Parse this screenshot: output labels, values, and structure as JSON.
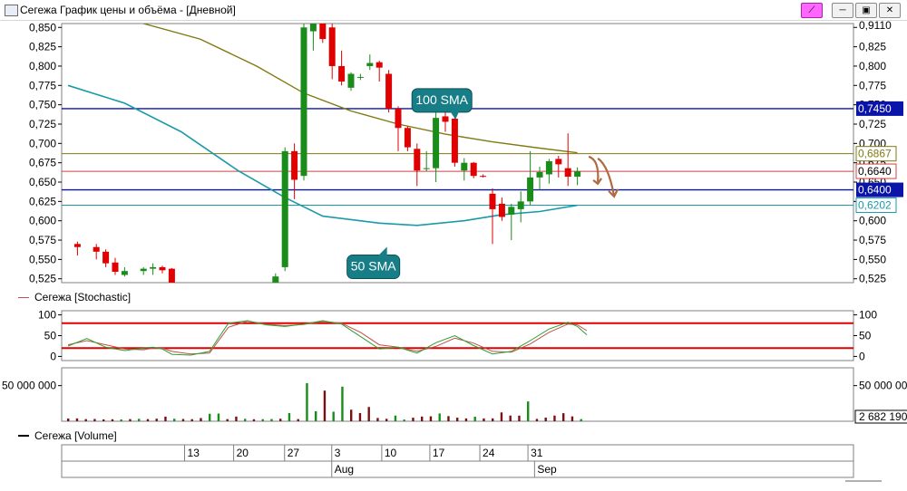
{
  "window": {
    "title": "Сегежа График цены и объёма - [Дневной]",
    "buttons": [
      "⟋",
      "─",
      "▣",
      "✕"
    ]
  },
  "colors": {
    "up_candle": "#1a8c1a",
    "down_candle": "#e00000",
    "sma50": "#1a9aa8",
    "sma100": "#807a12",
    "hline_blue": "#0a14a8",
    "hline_red": "#d04040",
    "callout_fill": "#177e88",
    "stoch_k": "#2aa02a",
    "stoch_d": "#c05050",
    "stoch_band": "#e00000",
    "arrow": "#b06a40"
  },
  "chart_data": [
    {
      "type": "candlestick",
      "panel": "price",
      "y_ticks": [
        "0,850",
        "0,825",
        "0,800",
        "0,775",
        "0,750",
        "0,725",
        "0,700",
        "0,675",
        "0,650",
        "0,625",
        "0,600",
        "0,575",
        "0,550",
        "0,525"
      ],
      "right_ticks": [
        "0,9110",
        "0,825",
        "0,800",
        "0,775",
        "0,750",
        "0,725",
        "0,700",
        "0,675",
        "0,650",
        "0,625",
        "0,600",
        "0,575",
        "0,550",
        "0,525"
      ],
      "ylim": [
        0.52,
        0.855
      ],
      "candles": [
        {
          "x": 1,
          "o": 0.57,
          "h": 0.573,
          "l": 0.555,
          "c": 0.566
        },
        {
          "x": 3,
          "o": 0.566,
          "h": 0.57,
          "l": 0.55,
          "c": 0.56
        },
        {
          "x": 4,
          "o": 0.56,
          "h": 0.563,
          "l": 0.54,
          "c": 0.545
        },
        {
          "x": 5,
          "o": 0.546,
          "h": 0.552,
          "l": 0.53,
          "c": 0.534
        },
        {
          "x": 6,
          "o": 0.53,
          "h": 0.54,
          "l": 0.528,
          "c": 0.535
        },
        {
          "x": 8,
          "o": 0.535,
          "h": 0.54,
          "l": 0.53,
          "c": 0.538
        },
        {
          "x": 9,
          "o": 0.538,
          "h": 0.545,
          "l": 0.53,
          "c": 0.54
        },
        {
          "x": 10,
          "o": 0.54,
          "h": 0.542,
          "l": 0.532,
          "c": 0.536
        },
        {
          "x": 11,
          "o": 0.538,
          "h": 0.539,
          "l": 0.518,
          "c": 0.52
        },
        {
          "x": 22,
          "o": 0.52,
          "h": 0.532,
          "l": 0.518,
          "c": 0.528
        },
        {
          "x": 23,
          "o": 0.54,
          "h": 0.695,
          "l": 0.535,
          "c": 0.69
        },
        {
          "x": 24,
          "o": 0.69,
          "h": 0.7,
          "l": 0.628,
          "c": 0.653
        },
        {
          "x": 25,
          "o": 0.658,
          "h": 0.87,
          "l": 0.652,
          "c": 0.85
        },
        {
          "x": 26,
          "o": 0.845,
          "h": 0.88,
          "l": 0.82,
          "c": 0.86
        },
        {
          "x": 27,
          "o": 0.86,
          "h": 0.872,
          "l": 0.83,
          "c": 0.835
        },
        {
          "x": 28,
          "o": 0.85,
          "h": 0.862,
          "l": 0.783,
          "c": 0.8
        },
        {
          "x": 29,
          "o": 0.8,
          "h": 0.82,
          "l": 0.775,
          "c": 0.78
        },
        {
          "x": 30,
          "o": 0.772,
          "h": 0.792,
          "l": 0.768,
          "c": 0.79
        },
        {
          "x": 31,
          "o": 0.785,
          "h": 0.79,
          "l": 0.782,
          "c": 0.786
        },
        {
          "x": 32,
          "o": 0.8,
          "h": 0.815,
          "l": 0.795,
          "c": 0.804
        },
        {
          "x": 33,
          "o": 0.805,
          "h": 0.807,
          "l": 0.78,
          "c": 0.798
        },
        {
          "x": 34,
          "o": 0.79,
          "h": 0.795,
          "l": 0.74,
          "c": 0.745
        },
        {
          "x": 35,
          "o": 0.745,
          "h": 0.748,
          "l": 0.69,
          "c": 0.72
        },
        {
          "x": 36,
          "o": 0.72,
          "h": 0.722,
          "l": 0.69,
          "c": 0.695
        },
        {
          "x": 37,
          "o": 0.693,
          "h": 0.7,
          "l": 0.645,
          "c": 0.665
        },
        {
          "x": 38,
          "o": 0.668,
          "h": 0.69,
          "l": 0.664,
          "c": 0.668
        },
        {
          "x": 39,
          "o": 0.668,
          "h": 0.742,
          "l": 0.65,
          "c": 0.733
        },
        {
          "x": 40,
          "o": 0.735,
          "h": 0.744,
          "l": 0.715,
          "c": 0.728
        },
        {
          "x": 41,
          "o": 0.732,
          "h": 0.736,
          "l": 0.67,
          "c": 0.675
        },
        {
          "x": 42,
          "o": 0.665,
          "h": 0.681,
          "l": 0.652,
          "c": 0.675
        },
        {
          "x": 43,
          "o": 0.675,
          "h": 0.676,
          "l": 0.655,
          "c": 0.658
        },
        {
          "x": 44,
          "o": 0.658,
          "h": 0.66,
          "l": 0.656,
          "c": 0.657
        },
        {
          "x": 45,
          "o": 0.635,
          "h": 0.642,
          "l": 0.57,
          "c": 0.615
        },
        {
          "x": 46,
          "o": 0.622,
          "h": 0.63,
          "l": 0.6,
          "c": 0.605
        },
        {
          "x": 47,
          "o": 0.608,
          "h": 0.622,
          "l": 0.575,
          "c": 0.618
        },
        {
          "x": 48,
          "o": 0.615,
          "h": 0.638,
          "l": 0.598,
          "c": 0.625
        },
        {
          "x": 49,
          "o": 0.625,
          "h": 0.69,
          "l": 0.62,
          "c": 0.656
        },
        {
          "x": 50,
          "o": 0.656,
          "h": 0.67,
          "l": 0.64,
          "c": 0.663
        },
        {
          "x": 51,
          "o": 0.66,
          "h": 0.68,
          "l": 0.648,
          "c": 0.677
        },
        {
          "x": 52,
          "o": 0.68,
          "h": 0.684,
          "l": 0.656,
          "c": 0.673
        },
        {
          "x": 53,
          "o": 0.668,
          "h": 0.713,
          "l": 0.645,
          "c": 0.657
        },
        {
          "x": 54,
          "o": 0.657,
          "h": 0.669,
          "l": 0.646,
          "c": 0.664
        }
      ],
      "x_count": 64,
      "sma50": [
        [
          0,
          0.775
        ],
        [
          6,
          0.752
        ],
        [
          12,
          0.715
        ],
        [
          18,
          0.665
        ],
        [
          23,
          0.63
        ],
        [
          27,
          0.606
        ],
        [
          33,
          0.597
        ],
        [
          37,
          0.594
        ],
        [
          42,
          0.6
        ],
        [
          46,
          0.608
        ],
        [
          50,
          0.612
        ],
        [
          54,
          0.62
        ]
      ],
      "sma100": [
        [
          8,
          0.855
        ],
        [
          14,
          0.835
        ],
        [
          20,
          0.8
        ],
        [
          25,
          0.765
        ],
        [
          30,
          0.742
        ],
        [
          35,
          0.725
        ],
        [
          40,
          0.712
        ],
        [
          45,
          0.702
        ],
        [
          50,
          0.694
        ],
        [
          54,
          0.688
        ]
      ],
      "hlines": [
        {
          "value": 0.745,
          "label": "0,7450",
          "style": "blue",
          "labeled": "inverse"
        },
        {
          "value": 0.6867,
          "label": "0,6867",
          "style": "olive",
          "labeled": "box"
        },
        {
          "value": 0.664,
          "label": "0,6640",
          "style": "red",
          "labeled": "box"
        },
        {
          "value": 0.64,
          "label": "0,6400",
          "style": "blue",
          "labeled": "inverse"
        },
        {
          "value": 0.6202,
          "label": "0,6202",
          "style": "teal",
          "labeled": "box"
        }
      ],
      "annotations": [
        {
          "text": "100 SMA",
          "anchor_x": 40.5,
          "anchor_value": 0.738
        },
        {
          "text": "50 SMA",
          "anchor_x": 34.2,
          "anchor_value": 0.558
        }
      ]
    },
    {
      "type": "line",
      "panel": "stochastic",
      "legend": "Сегежа [Stochastic]",
      "y_ticks": [
        "100",
        "50",
        "0"
      ],
      "ylim": [
        -10,
        110
      ],
      "bands": [
        80,
        20
      ],
      "k": [
        [
          0,
          25
        ],
        [
          2,
          43
        ],
        [
          4,
          22
        ],
        [
          6,
          14
        ],
        [
          8,
          20
        ],
        [
          9,
          22
        ],
        [
          10,
          18
        ],
        [
          11,
          5
        ],
        [
          13,
          3
        ],
        [
          15,
          12
        ],
        [
          17,
          80
        ],
        [
          19,
          86
        ],
        [
          21,
          76
        ],
        [
          23,
          72
        ],
        [
          25,
          78
        ],
        [
          27,
          86
        ],
        [
          29,
          78
        ],
        [
          31,
          48
        ],
        [
          33,
          18
        ],
        [
          35,
          22
        ],
        [
          37,
          8
        ],
        [
          39,
          33
        ],
        [
          41,
          50
        ],
        [
          43,
          26
        ],
        [
          45,
          6
        ],
        [
          47,
          12
        ],
        [
          49,
          38
        ],
        [
          51,
          66
        ],
        [
          53,
          82
        ],
        [
          54,
          72
        ],
        [
          55,
          52
        ]
      ],
      "d": [
        [
          0,
          28
        ],
        [
          2,
          38
        ],
        [
          4,
          28
        ],
        [
          6,
          18
        ],
        [
          8,
          16
        ],
        [
          9,
          20
        ],
        [
          10,
          20
        ],
        [
          11,
          12
        ],
        [
          13,
          6
        ],
        [
          15,
          8
        ],
        [
          17,
          70
        ],
        [
          19,
          85
        ],
        [
          21,
          78
        ],
        [
          23,
          74
        ],
        [
          25,
          77
        ],
        [
          27,
          84
        ],
        [
          29,
          80
        ],
        [
          31,
          58
        ],
        [
          33,
          28
        ],
        [
          35,
          22
        ],
        [
          37,
          12
        ],
        [
          39,
          24
        ],
        [
          41,
          44
        ],
        [
          43,
          32
        ],
        [
          45,
          12
        ],
        [
          47,
          10
        ],
        [
          49,
          30
        ],
        [
          51,
          58
        ],
        [
          53,
          78
        ],
        [
          54,
          76
        ],
        [
          55,
          62
        ]
      ]
    },
    {
      "type": "bar",
      "panel": "volume",
      "legend": "Сегежа [Volume]",
      "left_tick": "50 000 000",
      "right_ticks": [
        "50 000 000",
        "2 682 190"
      ],
      "ylim": [
        0,
        75000000
      ],
      "bars": [
        [
          0,
          3.8,
          "d"
        ],
        [
          1,
          4.0,
          "d"
        ],
        [
          2,
          3.0,
          "d"
        ],
        [
          3,
          3.2,
          "d"
        ],
        [
          4,
          2.6,
          "d"
        ],
        [
          5,
          2.8,
          "d"
        ],
        [
          6,
          2.5,
          "u"
        ],
        [
          7,
          3.0,
          "d"
        ],
        [
          8,
          3.4,
          "u"
        ],
        [
          9,
          3.0,
          "d"
        ],
        [
          10,
          3.6,
          "d"
        ],
        [
          11,
          6.5,
          "d"
        ],
        [
          12,
          3.5,
          "u"
        ],
        [
          13,
          3.2,
          "d"
        ],
        [
          14,
          2.9,
          "d"
        ],
        [
          15,
          4.5,
          "d"
        ],
        [
          16,
          10.5,
          "u"
        ],
        [
          17,
          10.8,
          "u"
        ],
        [
          18,
          3.0,
          "d"
        ],
        [
          19,
          6.6,
          "d"
        ],
        [
          20,
          3.4,
          "u"
        ],
        [
          21,
          2.8,
          "d"
        ],
        [
          22,
          2.9,
          "u"
        ],
        [
          23,
          3.1,
          "u"
        ],
        [
          24,
          3.5,
          "d"
        ],
        [
          25,
          11.5,
          "u"
        ],
        [
          26,
          3.0,
          "d"
        ],
        [
          27,
          53.5,
          "u"
        ],
        [
          28,
          14.0,
          "u"
        ],
        [
          29,
          43.0,
          "d"
        ],
        [
          30,
          13.4,
          "u"
        ],
        [
          31,
          48.6,
          "u"
        ],
        [
          32,
          16.2,
          "d"
        ],
        [
          33,
          11.5,
          "d"
        ],
        [
          34,
          20.0,
          "d"
        ],
        [
          35,
          4.6,
          "d"
        ],
        [
          36,
          3.4,
          "d"
        ],
        [
          37,
          8.0,
          "u"
        ],
        [
          38,
          2.4,
          "u"
        ],
        [
          39,
          5.0,
          "d"
        ],
        [
          40,
          6.6,
          "d"
        ],
        [
          41,
          6.9,
          "d"
        ],
        [
          42,
          10.9,
          "u"
        ],
        [
          43,
          7.2,
          "d"
        ],
        [
          44,
          5.0,
          "d"
        ],
        [
          45,
          4.0,
          "d"
        ],
        [
          46,
          6.4,
          "u"
        ],
        [
          47,
          4.0,
          "d"
        ],
        [
          48,
          4.0,
          "d"
        ],
        [
          49,
          12.4,
          "d"
        ],
        [
          50,
          8.0,
          "d"
        ],
        [
          51,
          7.9,
          "d"
        ],
        [
          52,
          27.8,
          "u"
        ],
        [
          53,
          3.3,
          "d"
        ],
        [
          54,
          5.1,
          "d"
        ],
        [
          55,
          8.0,
          "d"
        ],
        [
          56,
          11.3,
          "d"
        ],
        [
          57,
          6.8,
          "d"
        ],
        [
          58,
          3.0,
          "u"
        ]
      ],
      "bar_units": "millions"
    }
  ],
  "time_axis": {
    "day_labels": [
      {
        "x": 6.3,
        "text": "13"
      },
      {
        "x": 11.5,
        "text": "20"
      },
      {
        "x": 16.9,
        "text": "27"
      },
      {
        "x": 21.9,
        "text": "3"
      },
      {
        "x": 27.2,
        "text": "10"
      },
      {
        "x": 32.3,
        "text": "17"
      },
      {
        "x": 37.6,
        "text": "24"
      },
      {
        "x": 42.7,
        "text": "31"
      }
    ],
    "month_labels": [
      {
        "x": 21.9,
        "text": "Aug"
      },
      {
        "x": 43.4,
        "text": "Sep"
      }
    ]
  }
}
